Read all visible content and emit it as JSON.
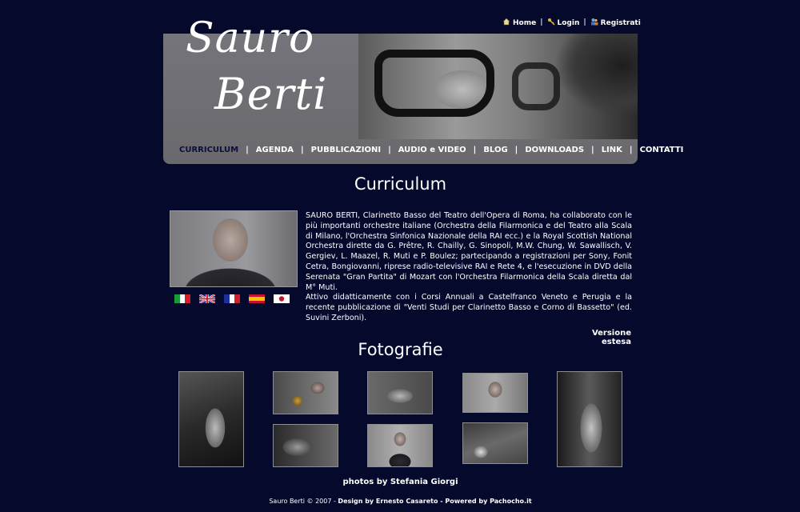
{
  "toplinks": {
    "home": "Home",
    "login": "Login",
    "registrati": "Registrati",
    "separator": "|"
  },
  "logo": {
    "line1": "Sauro",
    "line2": "Berti"
  },
  "nav": {
    "items": [
      "CURRICULUM",
      "AGENDA",
      "PUBBLICAZIONI",
      "AUDIO e VIDEO",
      "BLOG",
      "DOWNLOADS",
      "LINK",
      "CONTATTI"
    ],
    "active_index": 0,
    "separator": "|"
  },
  "curriculum": {
    "title": "Curriculum",
    "paragraph1": "SAURO BERTI, Clarinetto Basso del Teatro dell'Opera di Roma, ha collaborato con le più importanti orchestre italiane (Orchestra della Filarmonica e del Teatro alla Scala di Milano, l'Orchestra Sinfonica Nazionale della RAI ecc.) e la Royal Scottish National Orchestra dirette da G. Prêtre, R. Chailly, G. Sinopoli, M.W. Chung, W. Sawallisch, V. Gergiev, L. Maazel, R. Muti e P. Boulez; partecipando a registrazioni per Sony, Fonit Cetra, Bongiovanni, riprese radio-televisive RAI e Rete 4, e l'esecuzione in DVD della Serenata \"Gran Partita\" di Mozart con l'Orchestra Filarmonica della Scala diretta dal M° Muti.",
    "paragraph2": "Attivo didatticamente con i Corsi Annuali a Castelfranco Veneto e Perugia e la recente pubblicazione di \"Venti Studi per Clarinetto Basso e Corno di Bassetto\" (ed. Suvini Zerboni).",
    "versione": "Versione estesa",
    "flags": [
      "italian-flag",
      "uk-flag",
      "french-flag",
      "spanish-flag",
      "japanese-flag"
    ]
  },
  "fotografie": {
    "title": "Fotografie",
    "credit": "photos by Stefania Giorgi",
    "thumbs": [
      "photo-1",
      "photo-2",
      "photo-3",
      "photo-4",
      "photo-5",
      "photo-6",
      "photo-7",
      "photo-8"
    ]
  },
  "footer": {
    "copyright": "Sauro Berti © 2007 - ",
    "design": "Design by Ernesto Casareto",
    "middle": " - ",
    "powered": "Powered by Pachocho.it"
  },
  "colors": {
    "background": "#050a2c",
    "banner": "#727177",
    "active_nav": "#0b0f3a"
  }
}
